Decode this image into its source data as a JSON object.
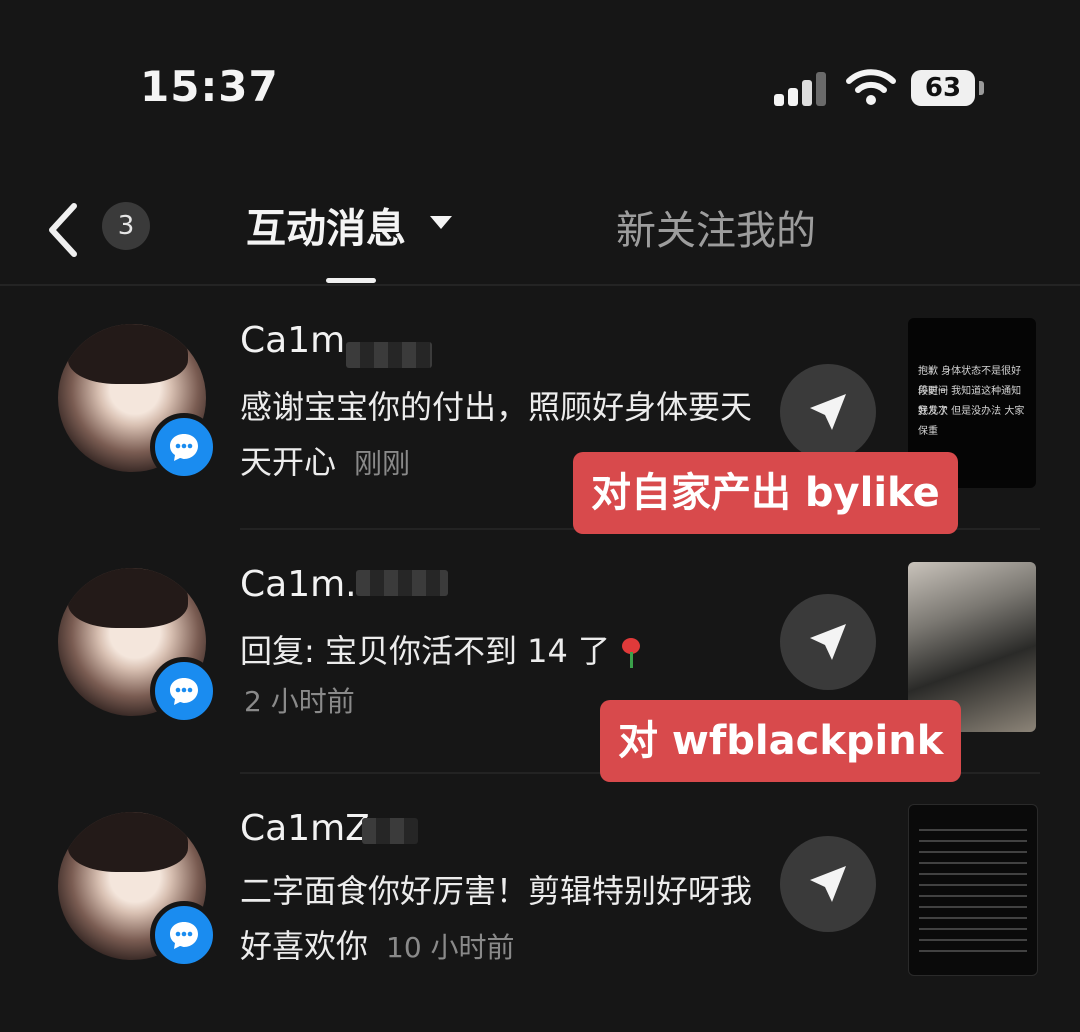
{
  "status_bar": {
    "time": "15:37",
    "battery": "63"
  },
  "header": {
    "unread_count": "3",
    "tabs": [
      {
        "label": "互动消息",
        "active": true
      },
      {
        "label": "新关注我的",
        "active": false
      }
    ]
  },
  "notifications": [
    {
      "username": "Ca1m",
      "message": "感谢宝宝你的付出，照顾好身体要天天开心",
      "time": "刚刚",
      "thumbnail_text": [
        "抱歉 身体状态不是很好 停更一",
        "段时间 我知道这种通知我发了",
        "好几次 但是没办法 大家保重"
      ],
      "annotation": "对自家产出 bylike"
    },
    {
      "username": "Ca1m.",
      "message": "回复: 宝贝你活不到 14 了",
      "time": "2 小时前",
      "annotation": "对 wfblackpink"
    },
    {
      "username": "Ca1mZ",
      "message": "二字面食你好厉害！剪辑特别好呀我好喜欢你",
      "time": "10 小时前"
    }
  ],
  "colors": {
    "background": "#161616",
    "chat_badge": "#1a8cf0",
    "annotation": "#d84a4c"
  }
}
